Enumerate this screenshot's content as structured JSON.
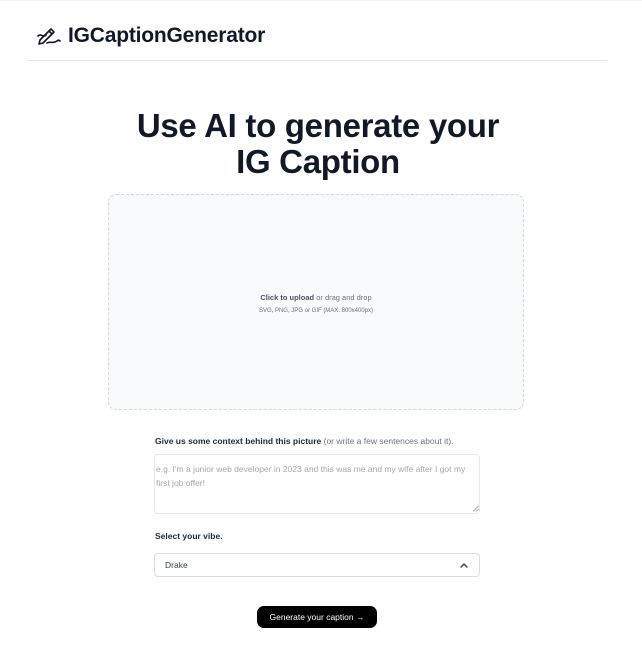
{
  "header": {
    "logo_icon": "pen-writing-icon",
    "app_name": "IGCaptionGenerator"
  },
  "hero": {
    "title_line1": "Use AI to generate your",
    "title_line2": "IG Caption"
  },
  "upload": {
    "click_label": "Click to upload",
    "drag_label": " or drag and drop",
    "formats": "SVG, PNG, JPG or GIF (MAX. 800x400px)"
  },
  "context": {
    "label_strong": "Give us some context behind this picture",
    "label_light": " (or write a few sentences about it).",
    "placeholder": "e.g. I'm a junior web developer in 2023 and this was me and my wife after I got my first job offer!"
  },
  "vibe": {
    "label": "Select your vibe.",
    "selected": "Drake",
    "icon": "chevron-up-icon"
  },
  "actions": {
    "generate_label": "Generate your caption →"
  },
  "colors": {
    "text": "#111827",
    "button_bg": "#000000",
    "button_text": "#ffffff",
    "dropzone_bg": "#f9fafb",
    "border": "#e5e7eb"
  }
}
